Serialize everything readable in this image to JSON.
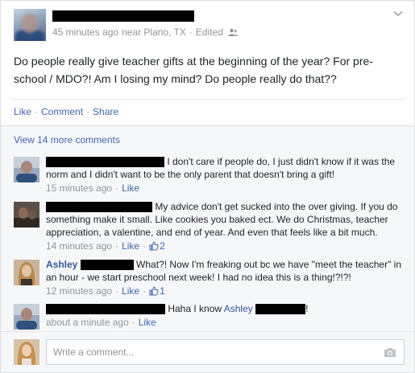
{
  "post": {
    "author_redacted": "",
    "timestamp": "45 minutes ago",
    "location": "near Plano, TX",
    "edited_label": "Edited",
    "audience_icon": "friends-icon",
    "menu_icon": "chevron-down-icon",
    "text": "Do people really give teacher gifts at the beginning of the year? For pre-school / MDO?! Am I losing my mind? Do people really do that??"
  },
  "actions": {
    "like": "Like",
    "comment": "Comment",
    "share": "Share",
    "separator": "·"
  },
  "comments_header": {
    "more_label": "View 14 more comments"
  },
  "comments": [
    {
      "name": "",
      "text": "I don't care if people do, I just didn't know if it was the norm and I didn't want to be the only parent that doesn't bring a gift!",
      "time": "15 minutes ago",
      "like_label": "Like",
      "like_count": ""
    },
    {
      "name": "",
      "text": "My advice don't get sucked into the over giving. If you do something make it small. Like cookies you baked ect. We do Christmas, teacher appreciation, a valentine, and end of year. And even that feels like a bit much.",
      "time": "14 minutes ago",
      "like_label": "Like",
      "like_count": "2"
    },
    {
      "name": "Ashley",
      "text": "What?! Now I'm freaking out bc we have \"meet the teacher\" in an hour - we start preschool next week! I had no idea this is a thing!?!?!",
      "time": "12 minutes ago",
      "like_label": "Like",
      "like_count": "1"
    },
    {
      "name": "",
      "text_prefix": "Haha I know",
      "mention": "Ashley",
      "text_suffix": "!",
      "time": "about a minute ago",
      "like_label": "Like",
      "like_count": ""
    }
  ],
  "compose": {
    "placeholder": "Write a comment...",
    "camera_icon": "camera-icon"
  },
  "colors": {
    "link": "#4267b2",
    "name": "#365899",
    "meta": "#90949c",
    "text": "#1d2129",
    "comments_bg": "#f6f7f9"
  }
}
